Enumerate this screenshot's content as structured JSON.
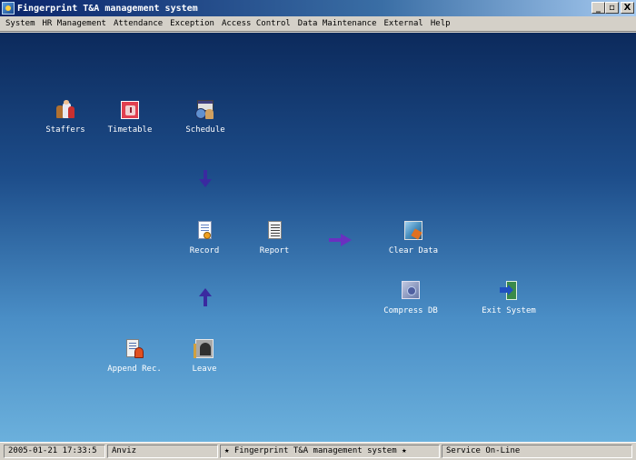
{
  "window": {
    "title": "Fingerprint T&A management system",
    "minimize_label": "_",
    "maximize_label": "▫",
    "close_label": "X"
  },
  "menu": [
    "System",
    "HR Management",
    "Attendance",
    "Exception",
    "Access Control",
    "Data Maintenance",
    "External",
    "Help"
  ],
  "shortcuts": {
    "staffers": "Staffers",
    "timetable": "Timetable",
    "schedule": "Schedule",
    "record": "Record",
    "report": "Report",
    "clear_data": "Clear Data",
    "compress_db": "Compress DB",
    "exit_system": "Exit System",
    "append_rec": "Append Rec.",
    "leave": "Leave"
  },
  "statusbar": {
    "datetime": "2005-01-21 17:33:5",
    "user": "Anviz",
    "banner": "★ Fingerprint T&A management system ★",
    "service": "Service On-Line"
  },
  "colors": {
    "desktop_top": "#0c2a5c",
    "desktop_bottom": "#6bb0dc",
    "arrow_vertical": "#3a2aa0",
    "arrow_horizontal": "#6a30c0"
  }
}
